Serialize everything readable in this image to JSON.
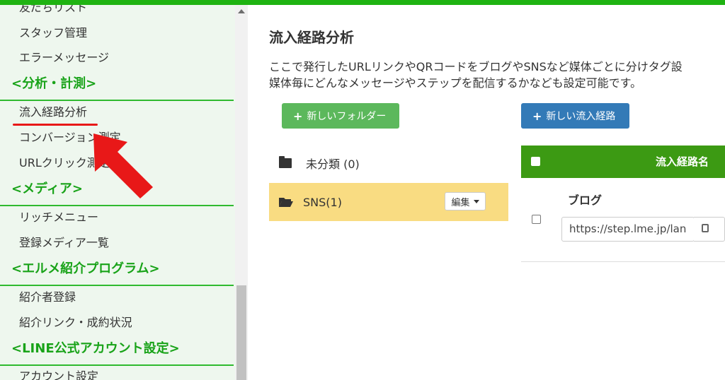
{
  "sidebar": {
    "items": [
      {
        "label": "友だちリスト"
      },
      {
        "label": "スタッフ管理"
      },
      {
        "label": "エラーメッセージ"
      }
    ],
    "sections": [
      {
        "heading": "<分析・計測>",
        "items": [
          "流入経路分析",
          "コンバージョン測定",
          "URLクリック測定"
        ]
      },
      {
        "heading": "<メディア>",
        "items": [
          "リッチメニュー",
          "登録メディア一覧"
        ]
      },
      {
        "heading": "<エルメ紹介プログラム>",
        "items": [
          "紹介者登録",
          "紹介リンク・成約状況"
        ]
      },
      {
        "heading": "<LINE公式アカウント設定>",
        "items": [
          "アカウント設定"
        ]
      }
    ]
  },
  "main": {
    "title": "流入経路分析",
    "description_line1": "ここで発行したURLリンクやQRコードをブログやSNSなど媒体ごとに分けタグ設",
    "description_line2": "媒体毎にどんなメッセージやステップを配信するかなども設定可能です。",
    "new_folder_button": "新しいフォルダー",
    "new_route_button": "新しい流入経路",
    "folders": [
      {
        "label": "未分類 (0)"
      },
      {
        "label": "SNS(1)",
        "edit_label": "編集"
      }
    ],
    "table": {
      "header": "流入経路名",
      "rows": [
        {
          "title": "ブログ",
          "url": "https://step.lme.jp/lan"
        }
      ]
    }
  },
  "colors": {
    "brand_green": "#1fb312",
    "sidebar_heading": "#19a319",
    "active_folder": "#f9dc82",
    "table_header": "#3c9a13",
    "annotation_red": "#e81818"
  }
}
